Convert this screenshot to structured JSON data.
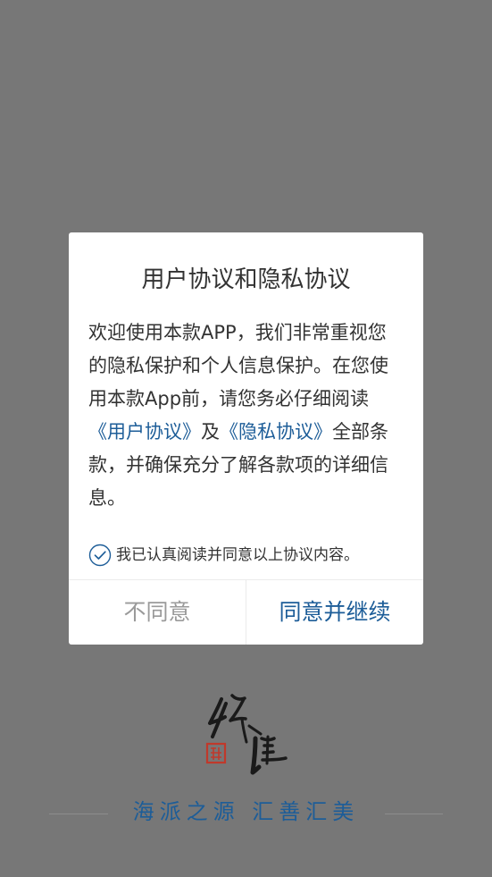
{
  "dialog": {
    "title": "用户协议和隐私协议",
    "body": {
      "intro": "欢迎使用本款APP，我们非常重视您的隐私保护和个人信息保护。在您使用本款App前，请您务必仔细阅读",
      "user_agreement_link": "《用户协议》",
      "conjunction": "及",
      "privacy_link": "《隐私协议》",
      "outro": "全部条款，并确保充分了解各款项的详细信息。"
    },
    "consent": {
      "label": "我已认真阅读并同意以上协议内容。",
      "checked": true
    },
    "disagree_label": "不同意",
    "agree_label": "同意并继续"
  },
  "brand": {
    "logo_icon": "calligraphy-logo-icon",
    "logo_text": "红淮",
    "slogan": "海派之源 汇善汇美"
  },
  "colors": {
    "overlay": "#777777",
    "accent": "#1d5d98",
    "text": "#333333",
    "muted": "#9a9a9a",
    "seal": "#c0392b"
  }
}
